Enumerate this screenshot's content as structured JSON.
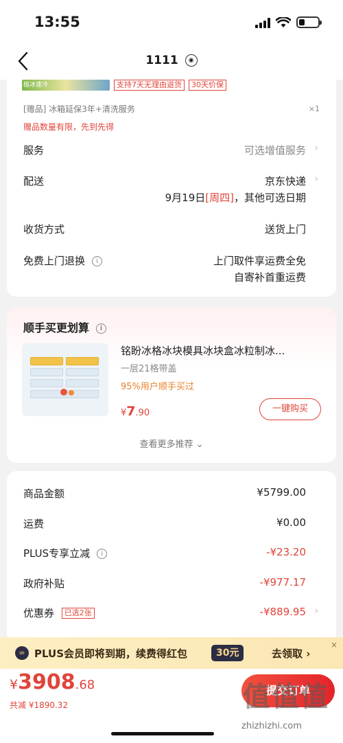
{
  "status_bar": {
    "time": "13:55"
  },
  "nav": {
    "title": "1111"
  },
  "product_tags": {
    "promo_image_text": "极冰速冷",
    "return_tag": "支持7天无理由退货",
    "price_tag": "30天价保"
  },
  "gift": {
    "text": "[赠品] 冰箱延保3年+清洗服务",
    "qty": "×1",
    "note": "赠品数量有限，先到先得"
  },
  "service": {
    "label": "服务",
    "value": "可选增值服务"
  },
  "delivery": {
    "label": "配送",
    "carrier": "京东快递",
    "date": "9月19日",
    "weekday": "[周四]",
    "other": "，其他可选日期"
  },
  "receive": {
    "label": "收货方式",
    "value": "送货上门"
  },
  "return_service": {
    "label": "免费上门退换",
    "line1": "上门取件享运费全免",
    "line2": "自寄补首重运费"
  },
  "recommend": {
    "title": "顺手买更划算",
    "product_name": "铭盼冰格冰块模具冰块盒冰粒制冰...",
    "spec": "一层21格带盖",
    "buyers": "95%用户顺手买过",
    "price_symbol": "¥",
    "price_int": "7",
    "price_dec": ".90",
    "buy_label": "一键购买",
    "see_more": "查看更多推荐"
  },
  "amounts": {
    "goods": {
      "label": "商品金额",
      "value": "¥5799.00"
    },
    "shipping": {
      "label": "运费",
      "value": "¥0.00"
    },
    "plus_discount": {
      "label": "PLUS专享立减",
      "value": "-¥23.20"
    },
    "subsidy": {
      "label": "政府补贴",
      "value": "-¥977.17"
    },
    "coupon": {
      "label": "优惠券",
      "tag": "已选2张",
      "value": "-¥889.95"
    }
  },
  "plus_banner": {
    "icon_text": "∞",
    "text": "PLUS会员即将到期，续费得红包",
    "badge": "30元",
    "cta": "去领取 ›",
    "close": "×"
  },
  "bottom": {
    "total_symbol": "¥",
    "total_int": "3908",
    "total_dec": ".68",
    "saved": "共减 ¥1890.32",
    "submit": "提交订单"
  },
  "watermark": {
    "logo": "值值值",
    "url": "zhizhizhi.com"
  },
  "colors": {
    "accent_red": "#e0443a",
    "plus_gold": "#fbe7b3",
    "plus_dark": "#2c2c44"
  }
}
